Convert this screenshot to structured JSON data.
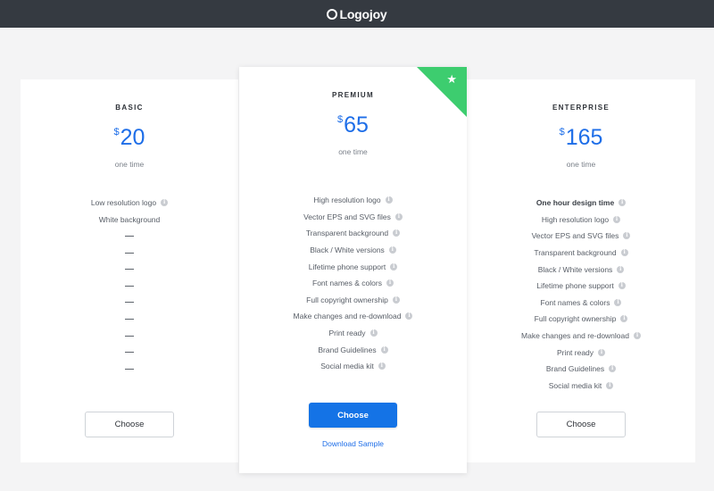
{
  "header": {
    "brand": "Logojoy",
    "logo_icon": "ring-logo-icon",
    "background": "#353a41"
  },
  "colors": {
    "accent": "#1473e6",
    "ribbon": "#3dcd6f"
  },
  "plans": [
    {
      "name": "BASIC",
      "currency": "$",
      "price": "20",
      "period": "one time",
      "features": [
        "Low resolution logo",
        "White background",
        "—",
        "—",
        "—",
        "—",
        "—",
        "—",
        "—",
        "—",
        "—"
      ],
      "cta": "Choose"
    },
    {
      "name": "PREMIUM",
      "currency": "$",
      "price": "65",
      "period": "one time",
      "badge_icon": "star-icon",
      "features": [
        "High resolution logo",
        "Vector EPS and SVG files",
        "Transparent background",
        "Black / White versions",
        "Lifetime phone support",
        "Font names & colors",
        "Full copyright ownership",
        "Make changes and re-download",
        "Print ready",
        "Brand Guidelines",
        "Social media kit"
      ],
      "cta": "Choose",
      "secondary_link": "Download Sample"
    },
    {
      "name": "ENTERPRISE",
      "currency": "$",
      "price": "165",
      "period": "one time",
      "features": [
        "One hour design time",
        "High resolution logo",
        "Vector EPS and SVG files",
        "Transparent background",
        "Black / White versions",
        "Lifetime phone support",
        "Font names & colors",
        "Full copyright ownership",
        "Make changes and re-download",
        "Print ready",
        "Brand Guidelines",
        "Social media kit"
      ],
      "cta": "Choose"
    }
  ]
}
